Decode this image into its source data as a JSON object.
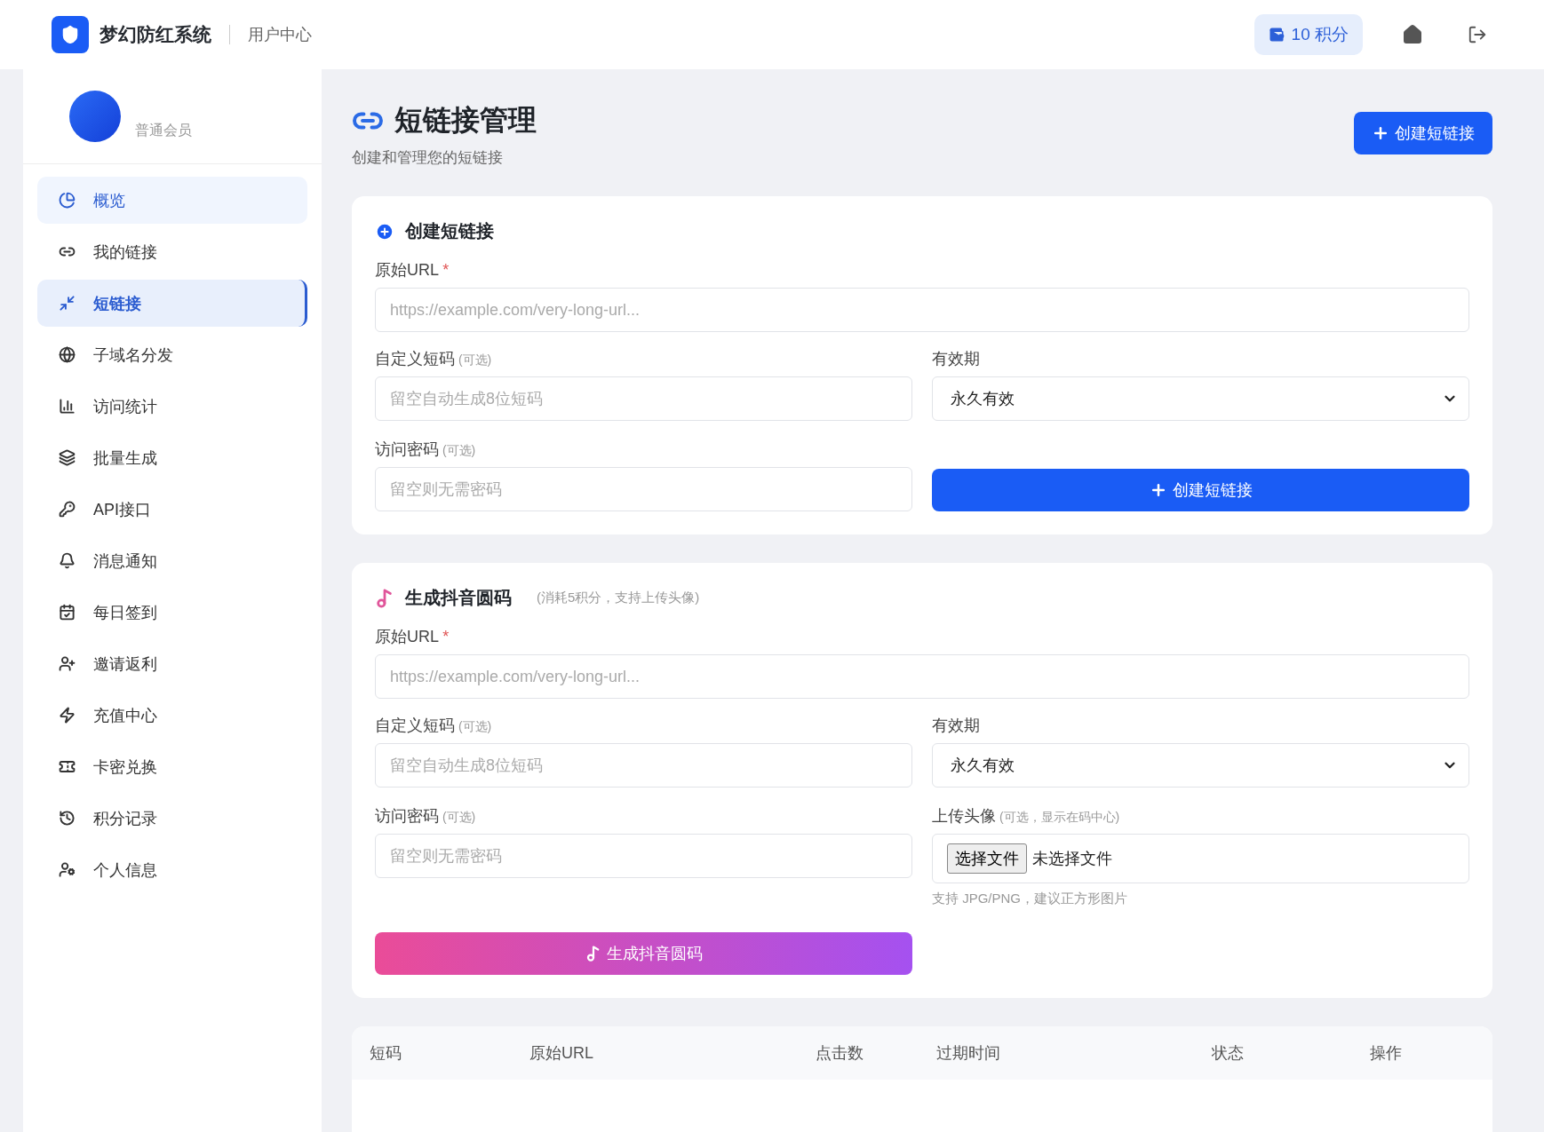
{
  "header": {
    "brand": "梦幻防红系统",
    "section": "用户中心",
    "points": "10 积分"
  },
  "profile": {
    "level": "普通会员"
  },
  "sidebar": {
    "items": [
      {
        "label": "概览",
        "selected": false,
        "hovered": true
      },
      {
        "label": "我的链接",
        "selected": false,
        "hovered": false
      },
      {
        "label": "短链接",
        "selected": true,
        "hovered": false
      },
      {
        "label": "子域名分发",
        "selected": false,
        "hovered": false
      },
      {
        "label": "访问统计",
        "selected": false,
        "hovered": false
      },
      {
        "label": "批量生成",
        "selected": false,
        "hovered": false
      },
      {
        "label": "API接口",
        "selected": false,
        "hovered": false
      },
      {
        "label": "消息通知",
        "selected": false,
        "hovered": false
      },
      {
        "label": "每日签到",
        "selected": false,
        "hovered": false
      },
      {
        "label": "邀请返利",
        "selected": false,
        "hovered": false
      },
      {
        "label": "充值中心",
        "selected": false,
        "hovered": false
      },
      {
        "label": "卡密兑换",
        "selected": false,
        "hovered": false
      },
      {
        "label": "积分记录",
        "selected": false,
        "hovered": false
      },
      {
        "label": "个人信息",
        "selected": false,
        "hovered": false
      }
    ]
  },
  "page": {
    "title": "短链接管理",
    "subtitle": "创建和管理您的短链接",
    "create_button": "创建短链接"
  },
  "short_link_card": {
    "title": "创建短链接",
    "url": {
      "label": "原始URL",
      "required": "*",
      "placeholder": "https://example.com/very-long-url..."
    },
    "code": {
      "label": "自定义短码",
      "note": "(可选)",
      "placeholder": "留空自动生成8位短码"
    },
    "expiry": {
      "label": "有效期",
      "value": "永久有效"
    },
    "password": {
      "label": "访问密码",
      "note": "(可选)",
      "placeholder": "留空则无需密码"
    },
    "submit": "创建短链接"
  },
  "douyin_card": {
    "title": "生成抖音圆码",
    "note": "(消耗5积分，支持上传头像)",
    "url": {
      "label": "原始URL",
      "required": "*",
      "placeholder": "https://example.com/very-long-url..."
    },
    "code": {
      "label": "自定义短码",
      "note": "(可选)",
      "placeholder": "留空自动生成8位短码"
    },
    "expiry": {
      "label": "有效期",
      "value": "永久有效"
    },
    "password": {
      "label": "访问密码",
      "note": "(可选)",
      "placeholder": "留空则无需密码"
    },
    "avatar": {
      "label": "上传头像",
      "note": "(可选，显示在码中心)",
      "button": "选择文件",
      "status": "未选择文件",
      "hint": "支持 JPG/PNG，建议正方形图片"
    },
    "submit": "生成抖音圆码"
  },
  "table": {
    "columns": [
      "短码",
      "原始URL",
      "点击数",
      "过期时间",
      "状态",
      "操作"
    ]
  }
}
